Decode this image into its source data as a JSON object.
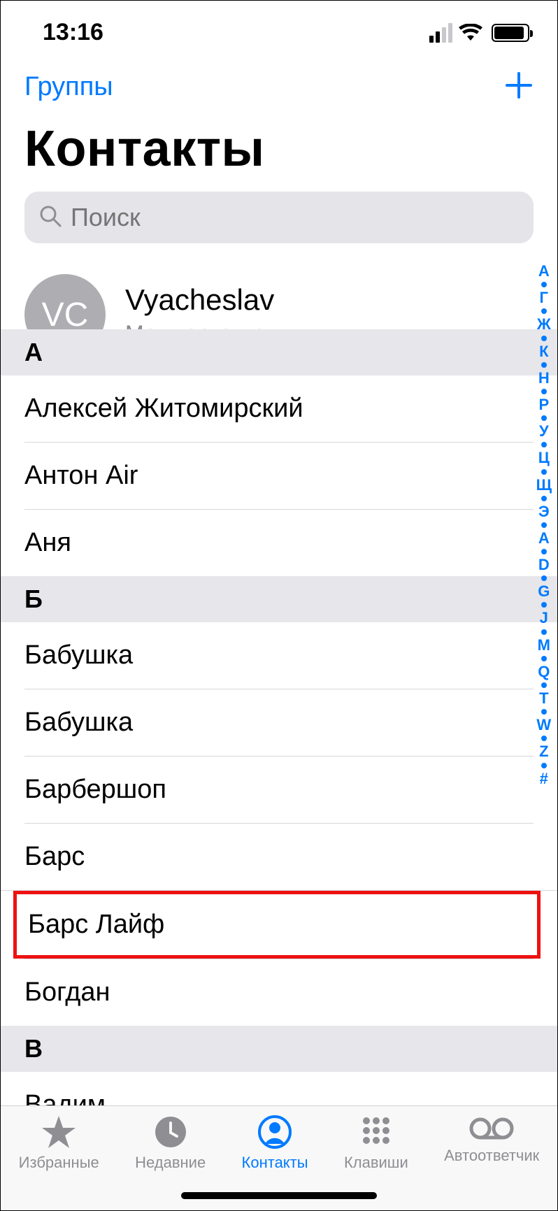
{
  "status": {
    "time": "13:16"
  },
  "nav": {
    "groups": "Группы"
  },
  "title": "Контакты",
  "search": {
    "placeholder": "Поиск"
  },
  "mycard": {
    "initials": "VC",
    "name": "Vyacheslav",
    "sub": "Моя карточка"
  },
  "sections": {
    "a": {
      "header": "А",
      "rows": [
        "Алексей Житомирский",
        "Антон Air",
        "Аня"
      ]
    },
    "b": {
      "header": "Б",
      "rows": [
        "Бабушка",
        "Бабушка",
        "Барбершоп",
        "Барс",
        "Барс Лайф",
        "Богдан"
      ]
    },
    "v": {
      "header": "В",
      "rows": [
        "Вадим"
      ]
    }
  },
  "highlighted_contact": "Барс Лайф",
  "index_letters": [
    "А",
    "Г",
    "Ж",
    "К",
    "Н",
    "Р",
    "У",
    "Ц",
    "Щ",
    "Э",
    "A",
    "D",
    "G",
    "J",
    "M",
    "Q",
    "T",
    "W",
    "Z",
    "#"
  ],
  "tabs": {
    "favorites": "Избранные",
    "recents": "Недавние",
    "contacts": "Контакты",
    "keypad": "Клавиши",
    "voicemail": "Автоответчик"
  }
}
